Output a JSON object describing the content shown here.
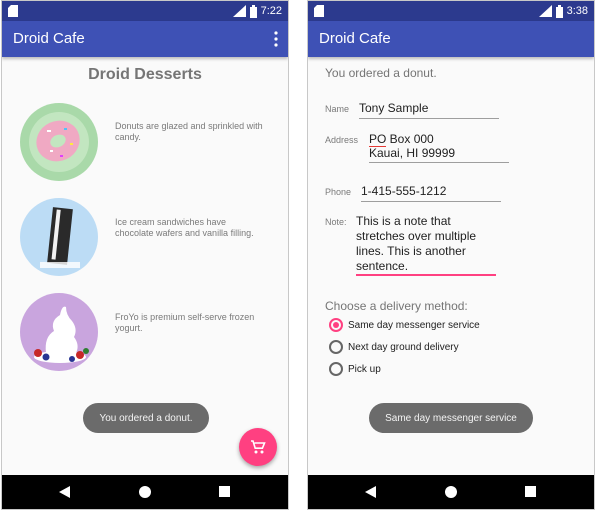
{
  "left": {
    "status": {
      "time": "7:22",
      "network": "LTE"
    },
    "app_title": "Droid Cafe",
    "heading": "Droid Desserts",
    "desserts": [
      {
        "name": "donut",
        "description": "Donuts are glazed and sprinkled with candy."
      },
      {
        "name": "ice-cream-sandwich",
        "description": "Ice cream sandwiches have chocolate wafers and vanilla filling."
      },
      {
        "name": "froyo",
        "description": "FroYo is premium self-serve frozen yogurt."
      }
    ],
    "toast": "You ordered a donut.",
    "fab_icon": "shopping-cart-icon"
  },
  "right": {
    "status": {
      "time": "3:38",
      "network": "LTE"
    },
    "app_title": "Droid Cafe",
    "order_message": "You ordered a donut.",
    "form": {
      "name_label": "Name",
      "name_value": "Tony Sample",
      "address_label": "Address",
      "address_line1_a": "PO",
      "address_line1_b": " Box 000",
      "address_line2": "Kauai, HI 99999",
      "phone_label": "Phone",
      "phone_value": "1-415-555-1212",
      "note_label": "Note:",
      "note_lines": [
        "This is a note that",
        "stretches over multiple",
        "lines. This is another",
        "sentence."
      ]
    },
    "delivery_heading": "Choose a delivery method:",
    "delivery_options": [
      {
        "label": "Same day messenger service",
        "selected": true
      },
      {
        "label": "Next day ground delivery",
        "selected": false
      },
      {
        "label": "Pick up",
        "selected": false
      }
    ],
    "toast": "Same day messenger service"
  },
  "colors": {
    "app_bar": "#3e51b5",
    "status_bar": "#2c3a8e",
    "accent": "#ff4081",
    "toast": "#6b6b6b"
  }
}
